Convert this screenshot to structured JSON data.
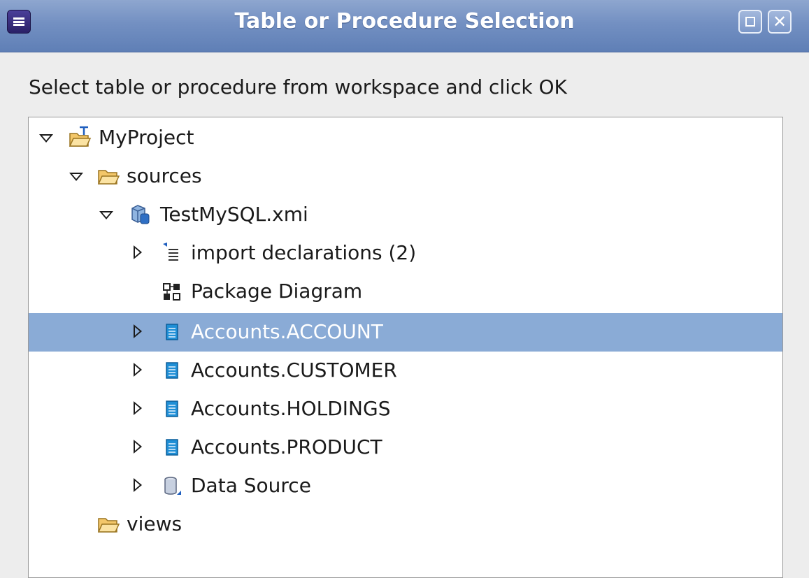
{
  "window": {
    "title": "Table or Procedure Selection"
  },
  "instruction": "Select table or procedure from workspace and click OK",
  "tree": {
    "items": [
      {
        "label": "MyProject",
        "icon": "project-folder-icon",
        "expanded": true
      },
      {
        "label": "sources",
        "icon": "folder-icon",
        "expanded": true
      },
      {
        "label": "TestMySQL.xmi",
        "icon": "model-file-icon",
        "expanded": true
      },
      {
        "label": "import declarations (2)",
        "icon": "import-declarations-icon",
        "expanded": false
      },
      {
        "label": "Package Diagram",
        "icon": "package-diagram-icon"
      },
      {
        "label": "Accounts.ACCOUNT",
        "icon": "table-icon",
        "expanded": false,
        "selected": true
      },
      {
        "label": "Accounts.CUSTOMER",
        "icon": "table-icon",
        "expanded": false
      },
      {
        "label": "Accounts.HOLDINGS",
        "icon": "table-icon",
        "expanded": false
      },
      {
        "label": "Accounts.PRODUCT",
        "icon": "table-icon",
        "expanded": false
      },
      {
        "label": "Data Source",
        "icon": "data-source-icon",
        "expanded": false
      },
      {
        "label": "views",
        "icon": "folder-icon"
      }
    ]
  },
  "colors": {
    "titlebar": "#7390c2",
    "selection": "#8aabd6",
    "table_icon": "#1f8fd6"
  }
}
